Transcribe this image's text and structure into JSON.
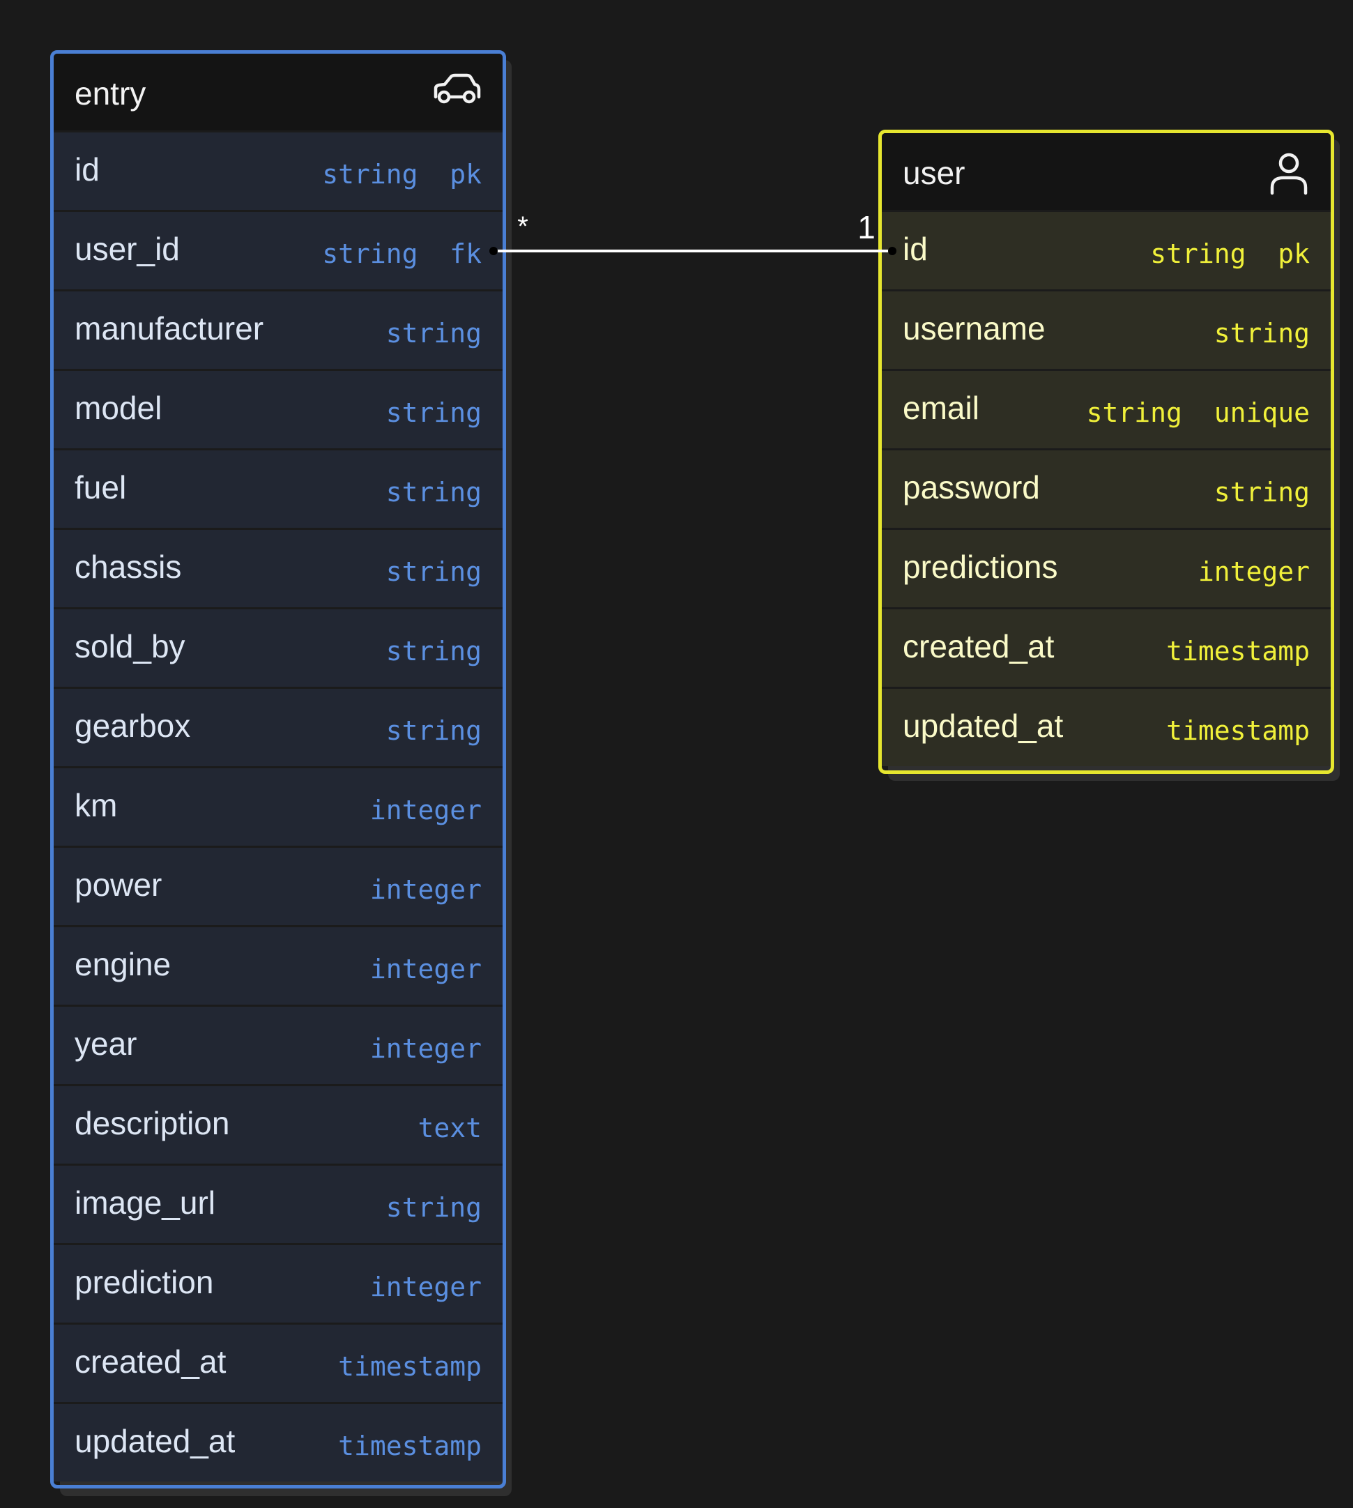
{
  "entry": {
    "title": "entry",
    "icon": "car-icon",
    "accent": "#4a7fd4",
    "fields": [
      {
        "name": "id",
        "type": "string",
        "key": "pk"
      },
      {
        "name": "user_id",
        "type": "string",
        "key": "fk"
      },
      {
        "name": "manufacturer",
        "type": "string",
        "key": ""
      },
      {
        "name": "model",
        "type": "string",
        "key": ""
      },
      {
        "name": "fuel",
        "type": "string",
        "key": ""
      },
      {
        "name": "chassis",
        "type": "string",
        "key": ""
      },
      {
        "name": "sold_by",
        "type": "string",
        "key": ""
      },
      {
        "name": "gearbox",
        "type": "string",
        "key": ""
      },
      {
        "name": "km",
        "type": "integer",
        "key": ""
      },
      {
        "name": "power",
        "type": "integer",
        "key": ""
      },
      {
        "name": "engine",
        "type": "integer",
        "key": ""
      },
      {
        "name": "year",
        "type": "integer",
        "key": ""
      },
      {
        "name": "description",
        "type": "text",
        "key": ""
      },
      {
        "name": "image_url",
        "type": "string",
        "key": ""
      },
      {
        "name": "prediction",
        "type": "integer",
        "key": ""
      },
      {
        "name": "created_at",
        "type": "timestamp",
        "key": ""
      },
      {
        "name": "updated_at",
        "type": "timestamp",
        "key": ""
      }
    ]
  },
  "user": {
    "title": "user",
    "icon": "user-icon",
    "accent": "#e6e62f",
    "fields": [
      {
        "name": "id",
        "type": "string",
        "key": "pk"
      },
      {
        "name": "username",
        "type": "string",
        "key": ""
      },
      {
        "name": "email",
        "type": "string",
        "key": "unique"
      },
      {
        "name": "password",
        "type": "string",
        "key": ""
      },
      {
        "name": "predictions",
        "type": "integer",
        "key": ""
      },
      {
        "name": "created_at",
        "type": "timestamp",
        "key": ""
      },
      {
        "name": "updated_at",
        "type": "timestamp",
        "key": ""
      }
    ]
  },
  "relationship": {
    "from_table": "entry",
    "from_field": "user_id",
    "from_cardinality": "*",
    "to_table": "user",
    "to_field": "id",
    "to_cardinality": "1"
  }
}
